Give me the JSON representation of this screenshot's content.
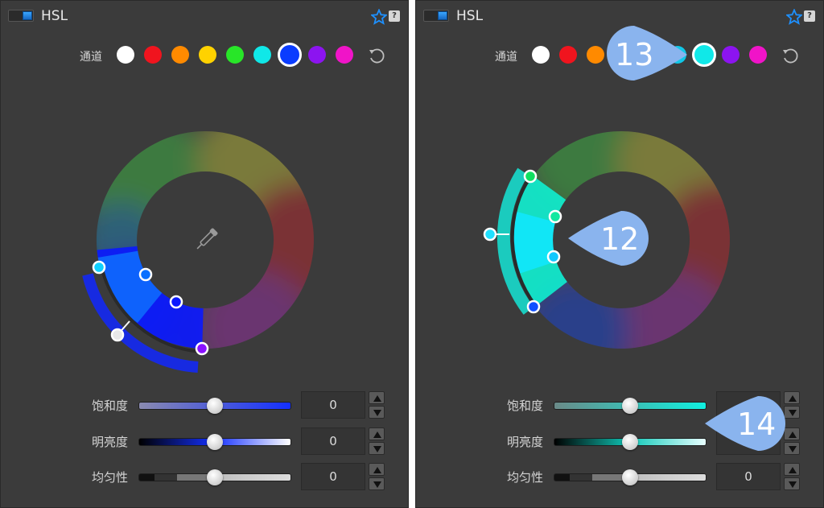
{
  "panels": [
    {
      "title": "HSL",
      "channel_label": "通道",
      "selected_channel": "blue",
      "sliders": [
        {
          "label": "饱和度",
          "value": "0",
          "position": 0.5
        },
        {
          "label": "明亮度",
          "value": "0",
          "position": 0.5
        },
        {
          "label": "均匀性",
          "value": "0",
          "position": 0.5
        }
      ]
    },
    {
      "title": "HSL",
      "channel_label": "通道",
      "selected_channel": "cyan",
      "sliders": [
        {
          "label": "饱和度",
          "value": "",
          "position": 0.5
        },
        {
          "label": "明亮度",
          "value": "",
          "position": 0.5
        },
        {
          "label": "均匀性",
          "value": "0",
          "position": 0.5
        }
      ]
    }
  ],
  "callouts": {
    "callout_12": "12",
    "callout_13": "13",
    "callout_14": "14"
  },
  "colors": {
    "accent": "#1e90ff",
    "callout": "#8ab4ee",
    "swatch_white": "#ffffff",
    "swatch_red": "#f0141e",
    "swatch_orange": "#ff8a00",
    "swatch_yellow": "#ffd200",
    "swatch_green": "#28e628",
    "swatch_cyan": "#10e8e8",
    "swatch_blue": "#0a3cff",
    "swatch_purple": "#8c14f0",
    "swatch_magenta": "#f014c8"
  },
  "icons": [
    "star-icon",
    "help-icon",
    "reset-icon",
    "eyedropper-icon",
    "chevron-up-icon",
    "chevron-down-icon"
  ]
}
